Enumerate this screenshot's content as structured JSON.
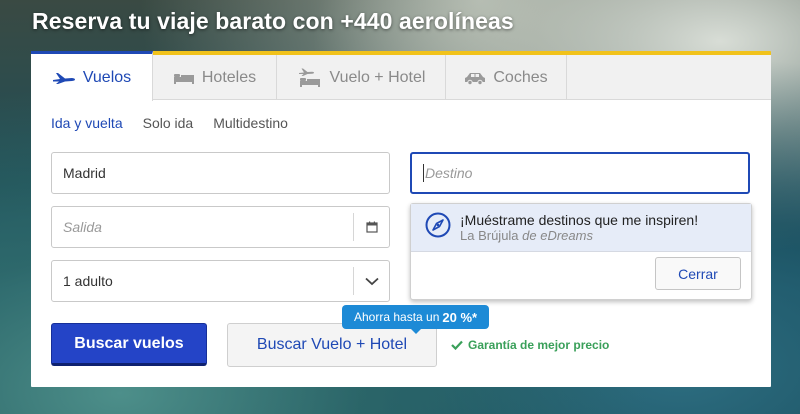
{
  "hero": {
    "title": "Reserva tu viaje barato con +440 aerolíneas"
  },
  "tabs": [
    {
      "label": "Vuelos",
      "icon": "plane-icon",
      "active": true
    },
    {
      "label": "Hoteles",
      "icon": "bed-icon",
      "active": false
    },
    {
      "label": "Vuelo + Hotel",
      "icon": "plane-bed-icon",
      "active": false
    },
    {
      "label": "Coches",
      "icon": "car-icon",
      "active": false
    }
  ],
  "trip_types": [
    {
      "label": "Ida y vuelta",
      "selected": true
    },
    {
      "label": "Solo ida",
      "selected": false
    },
    {
      "label": "Multidestino",
      "selected": false
    }
  ],
  "form": {
    "origin_value": "Madrid",
    "destination_placeholder": "Destino",
    "departure_placeholder": "Salida",
    "passengers_value": "1 adulto"
  },
  "dropdown": {
    "suggest_title": "¡Muéstrame destinos que me inspiren!",
    "suggest_sub_prefix": "La Brújula ",
    "suggest_sub_brand": "de eDreams",
    "close_label": "Cerrar"
  },
  "actions": {
    "search_label": "Buscar vuelos",
    "combo_label": "Buscar Vuelo + Hotel",
    "promo_prefix": "Ahorra hasta un",
    "promo_value": "20 %*",
    "guarantee": "Garantía de mejor precio"
  },
  "colors": {
    "brand_blue": "#1f49b5",
    "accent_yellow": "#f1c21b",
    "promo_blue": "#1d8ad6",
    "success_green": "#3aa05a"
  }
}
